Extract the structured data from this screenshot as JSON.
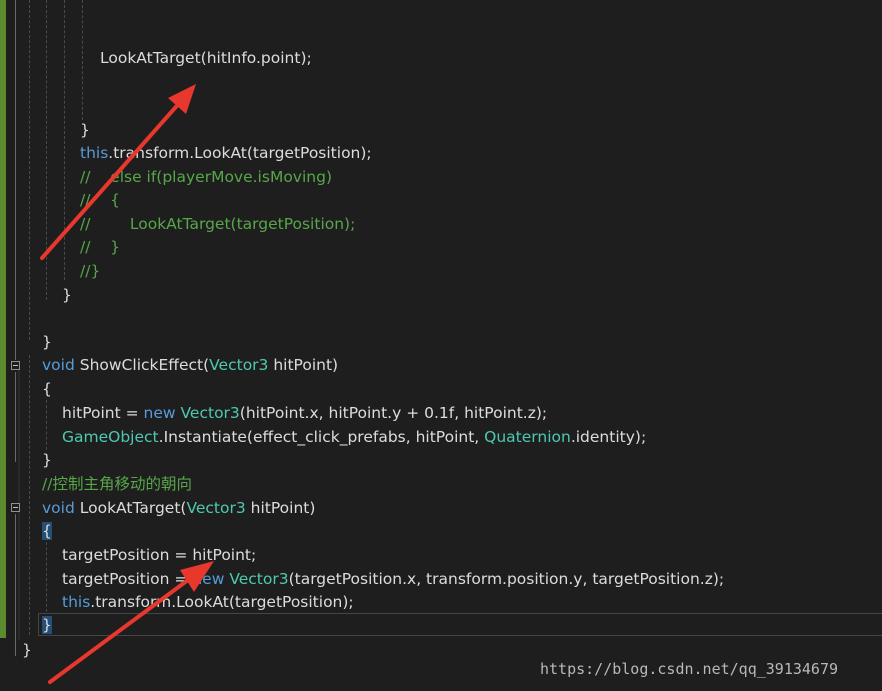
{
  "editor": {
    "lines": {
      "l1": "LookAtTarget(hitInfo.point);",
      "l2": "}",
      "l3_kw": "this",
      "l3_rest": ".transform.LookAt(targetPosition);",
      "l4": "//    else if(playerMove.isMoving)",
      "l5": "//    {",
      "l6": "//        LookAtTarget(targetPosition);",
      "l7": "//    }",
      "l8": "//}",
      "l9": "}",
      "l10": "}",
      "l11_kw": "void",
      "l11_name": " ShowClickEffect(",
      "l11_type": "Vector3",
      "l11_rest": " hitPoint)",
      "l12": "{",
      "l13_a": "hitPoint = ",
      "l13_kw": "new",
      "l13_sp": " ",
      "l13_type": "Vector3",
      "l13_rest": "(hitPoint.x, hitPoint.y + 0.1f, hitPoint.z);",
      "l14_type": "GameObject",
      "l14_mid": ".Instantiate(effect_click_prefabs, hitPoint, ",
      "l14_type2": "Quaternion",
      "l14_rest": ".identity);",
      "l15": "}",
      "l16": "//控制主角移动的朝向",
      "l17_kw": "void",
      "l17_name": " LookAtTarget(",
      "l17_type": "Vector3",
      "l17_rest": " hitPoint)",
      "l18": "{",
      "l19": "targetPosition = hitPoint;",
      "l20_a": "targetPosition = ",
      "l20_kw": "new",
      "l20_sp": " ",
      "l20_type": "Vector3",
      "l20_rest": "(targetPosition.x, transform.position.y, targetPosition.z);",
      "l21_kw": "this",
      "l21_rest": ".transform.LookAt(targetPosition);",
      "l22": "}",
      "l23": "}"
    }
  },
  "watermark": "https://blog.csdn.net/qq_39134679",
  "colors": {
    "background": "#1e1e1e",
    "keyword": "#569cd6",
    "type": "#4ec9b0",
    "comment": "#57a64a",
    "text": "#dcdcdc",
    "arrow": "#e8372c"
  }
}
